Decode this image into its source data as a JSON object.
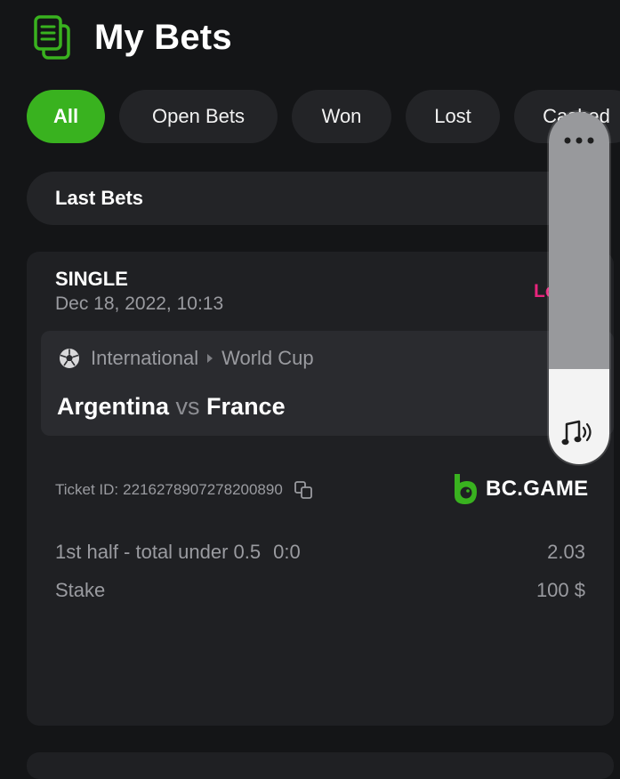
{
  "header": {
    "title": "My Bets",
    "icon": "bet-slip-icon"
  },
  "tabs": [
    {
      "label": "All",
      "active": true
    },
    {
      "label": "Open Bets",
      "active": false
    },
    {
      "label": "Won",
      "active": false
    },
    {
      "label": "Lost",
      "active": false
    },
    {
      "label": "Cashed",
      "active": false
    }
  ],
  "filter": {
    "label": "Last Bets"
  },
  "bet": {
    "type": "SINGLE",
    "date": "Dec 18, 2022, 10:13",
    "status": "Lost",
    "category": "International",
    "tournament": "World Cup",
    "home_team": "Argentina",
    "vs": "vs",
    "away_team": "France",
    "ticket_label": "Ticket ID:",
    "ticket_id": "2216278907278200890",
    "brand": "BC.GAME",
    "market": "1st half - total under 0.5",
    "score": "0:0",
    "odds": "2.03",
    "stake_label": "Stake",
    "stake_value": "100 $"
  },
  "volume_overlay": {
    "level": 0.27,
    "icon": "sound-icon"
  },
  "colors": {
    "accent": "#39b21f",
    "lost": "#e8247c",
    "background": "#141517",
    "card": "#1f2023"
  }
}
